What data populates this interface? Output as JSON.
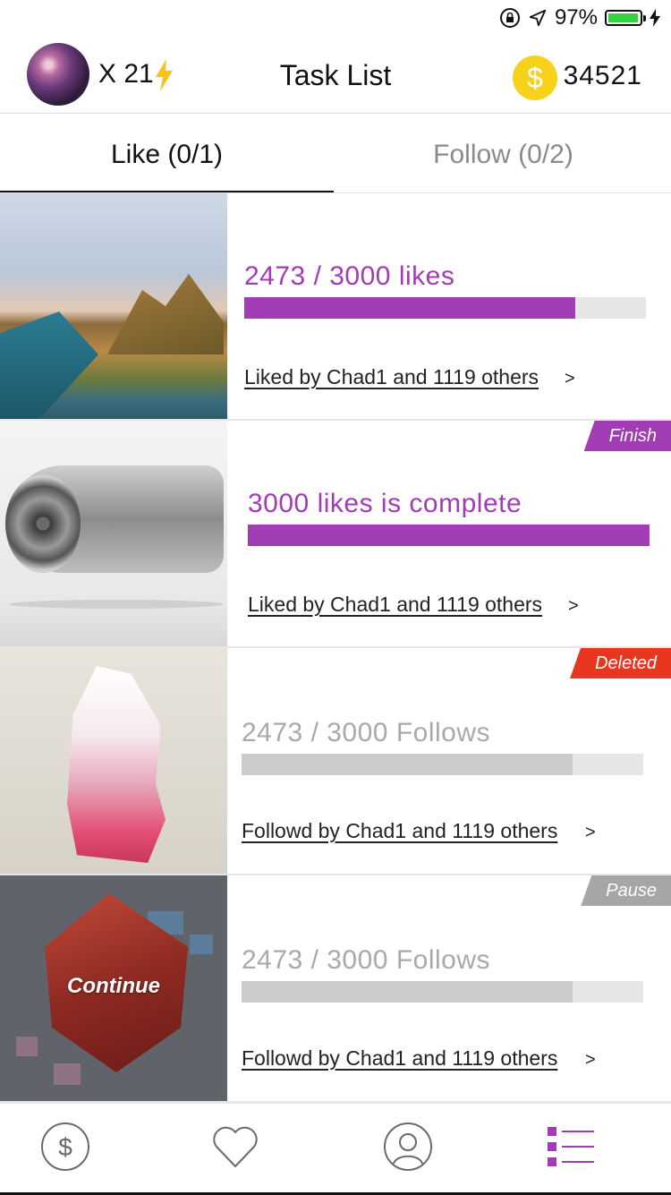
{
  "status_bar": {
    "battery_text": "97%",
    "battery_level": 0.97,
    "battery_color": "#35d13e",
    "icons": [
      "orientation-lock-icon",
      "location-arrow-icon",
      "battery-icon",
      "charging-bolt-icon"
    ]
  },
  "header": {
    "multiplier": "X 21",
    "title": "Task List",
    "coins": "34521",
    "coin_symbol": "$",
    "accent_yellow": "#f7d21c"
  },
  "tabs": [
    {
      "label": "Like (0/1)",
      "active": true
    },
    {
      "label": "Follow (0/2)",
      "active": false
    }
  ],
  "tasks": [
    {
      "image": "coastal-landscape",
      "progress_text": "2473 / 3000 likes",
      "progress": 0.8243,
      "link_text": "Liked by Chad1 and 1119 others",
      "link_arrow": ">",
      "badge": "",
      "color": "#a23cb4"
    },
    {
      "image": "jet-engine",
      "progress_text": "3000 likes is complete",
      "progress": 1.0,
      "link_text": "Liked by Chad1 and 1119 others",
      "link_arrow": ">",
      "badge": "Finish",
      "badge_color": "#a23cb4",
      "color": "#a23cb4"
    },
    {
      "image": "pink-crystal",
      "progress_text": "2473 / 3000 Follows",
      "progress": 0.8243,
      "link_text": "Followd by Chad1 and 1119 others",
      "link_arrow": ">",
      "badge": "Deleted",
      "badge_color": "#e8361f",
      "color": "#a9a9a9"
    },
    {
      "image": "red-gem-locked",
      "overlay_text": "Continue",
      "progress_text": "2473 / 3000 Follows",
      "progress": 0.8243,
      "link_text": "Followd by Chad1 and 1119 others",
      "link_arrow": ">",
      "badge": "Pause",
      "badge_color": "#a6a6a6",
      "color": "#a9a9a9"
    }
  ],
  "bottom_nav": [
    {
      "icon": "dollar-circle-icon",
      "active": false
    },
    {
      "icon": "heart-icon",
      "active": false
    },
    {
      "icon": "profile-circle-icon",
      "active": false
    },
    {
      "icon": "task-list-icon",
      "active": true
    }
  ]
}
